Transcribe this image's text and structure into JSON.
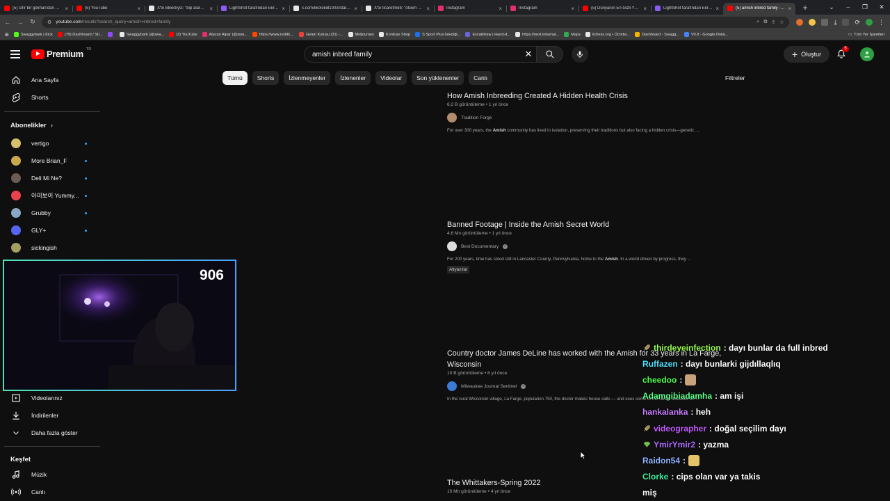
{
  "browser": {
    "tabs": [
      {
        "label": "(5) sıfır bir gökhan'dan mesaj",
        "fav_color": "#ff0000",
        "active": false
      },
      {
        "label": "(5) YouTube",
        "fav_color": "#ff0000",
        "active": false
      },
      {
        "label": "X'te BBeckyG: \"bip alarmı ...",
        "fav_color": "#e7e7e7",
        "active": false
      },
      {
        "label": "LightShot tarafından Ekran ...",
        "fav_color": "#8b5cf6",
        "active": false
      },
      {
        "label": "x.com/kkoloki81003/statu...",
        "fav_color": "#e7e7e7",
        "active": false
      },
      {
        "label": "X'te ticaretmeb: \"ölcem an...",
        "fav_color": "#e7e7e7",
        "active": false
      },
      {
        "label": "Instagram",
        "fav_color": "#e1306c",
        "active": false
      },
      {
        "label": "Instagram",
        "fav_color": "#e1306c",
        "active": false
      },
      {
        "label": "(5) Dünyanın En Gizli Yaba...",
        "fav_color": "#ff0000",
        "active": false
      },
      {
        "label": "LightShot tarafından Ekran ...",
        "fav_color": "#8b5cf6",
        "active": false
      },
      {
        "label": "(5) amish inbred family - Yo",
        "fav_color": "#ff0000",
        "active": true
      }
    ],
    "url_host": "youtube.com",
    "url_path": "/results?search_query=amish+inbred+family",
    "bookmarks": [
      {
        "label": "Swaggybark | Kick",
        "color": "#53fc18"
      },
      {
        "label": "(79) Dashboard / Str...",
        "color": "#ff0000"
      },
      {
        "label": "",
        "color": "#9146ff"
      },
      {
        "label": "Swaggybark (@swa...",
        "color": "#e7e7e7"
      },
      {
        "label": "(2) YouTube",
        "color": "#ff0000"
      },
      {
        "label": "Alpcan Alpar (@swa...",
        "color": "#e1306c"
      },
      {
        "label": "https://www.reddit....",
        "color": "#ff4500"
      },
      {
        "label": "Gelen Kutusu (31) -...",
        "color": "#ea4335"
      },
      {
        "label": "Midjourney",
        "color": "#e7e7e7"
      },
      {
        "label": "Konfuse Shop",
        "color": "#e7e7e7"
      },
      {
        "label": "S Sport Plus-İstediği...",
        "color": "#1a73e8"
      },
      {
        "label": "Excalidraw | Hand-d...",
        "color": "#6965db"
      },
      {
        "label": "https://next.inkamat...",
        "color": "#e7e7e7"
      },
      {
        "label": "Maps",
        "color": "#34a853"
      },
      {
        "label": "lichess.org • Ücretsi...",
        "color": "#e7e7e7"
      },
      {
        "label": "Dashboard - Swagg...",
        "color": "#f4b400"
      },
      {
        "label": "V0.8 - Google Dokü...",
        "color": "#4285f4"
      }
    ],
    "all_bookmarks": "Tüm Yer İşaretleri"
  },
  "header": {
    "logo_text": "Premium",
    "region": "TR",
    "search_query": "amish inbred family",
    "create_label": "Oluştur",
    "notifications": "5"
  },
  "sidebar": {
    "home": "Ana Sayfa",
    "shorts": "Shorts",
    "subs_heading": "Abonelikler",
    "subscriptions": [
      {
        "name": "vertigo",
        "color": "#d4c06a"
      },
      {
        "name": "More Brian_F",
        "color": "#c9a74f"
      },
      {
        "name": "Deli Mi Ne?",
        "color": "#6b5d55"
      },
      {
        "name": "아미보이 Yummy...",
        "color": "#e8424e"
      },
      {
        "name": "Grubby",
        "color": "#8aa8c4"
      },
      {
        "name": "GLY+",
        "color": "#5865f2"
      },
      {
        "name": "sickingish",
        "color": "#a0a060"
      }
    ],
    "videos": "Videolarınız",
    "downloads": "İndirilenler",
    "show_more": "Daha fazla göster",
    "explore_heading": "Keşfet",
    "music": "Müzik",
    "live": "Canlı"
  },
  "chips": [
    "Tümü",
    "Shorts",
    "İzlenmeyenler",
    "İzlenenler",
    "Videolar",
    "Son yüklenenler",
    "Canlı"
  ],
  "filters_label": "Filtreler",
  "results": [
    {
      "title": "How Amish Inbreeding Created A Hidden Health Crisis",
      "views": "6,2 B görüntüleme",
      "age": "1 yıl önce",
      "channel": "Tradition Forge",
      "verified": false,
      "channel_color": "#b38b6d",
      "desc_pre": "For over 300 years, the ",
      "desc_bold": "Amish",
      "desc_post": " community has lived in isolation, preserving their traditions but also facing a hidden crisis—genetic ...",
      "tag": ""
    },
    {
      "title": "Banned Footage | Inside the Amish Secret World",
      "views": "4,6 Mn görüntüleme",
      "age": "1 yıl önce",
      "channel": "Best Documentary",
      "verified": true,
      "channel_color": "#dcdcdc",
      "desc_pre": "For 200 years, time has stood still in Lancaster County, Pennsylvania, home to the ",
      "desc_bold": "Amish",
      "desc_post": ". In a world driven by progress, they ...",
      "tag": "Altyazılar"
    },
    {
      "title": "Country doctor James DeLine has worked with the Amish for 33 years in La Farge, Wisconsin",
      "views": "10 B görüntüleme",
      "age": "6 yıl önce",
      "channel": "Milwaukee Journal Sentinel",
      "verified": true,
      "channel_color": "#3a7bd5",
      "desc_pre": "In the rural Wisconsin village, La Farge, population 750, the doctor makes house calls — and sees some of the rarest diseases on ...",
      "desc_bold": "",
      "desc_post": "",
      "tag": ""
    },
    {
      "title": "The Whittakers-Spring 2022",
      "views": "10 Mn görüntüleme",
      "age": "4 yıl önce",
      "channel": "",
      "verified": false,
      "channel_color": "",
      "desc_pre": "",
      "desc_bold": "",
      "desc_post": "",
      "tag": ""
    }
  ],
  "webcam": {
    "counter": "906"
  },
  "chat": [
    {
      "user": "thirdeyeinfection",
      "color": "#9aff4f",
      "text": ": dayı bunlar da full inbred",
      "badge": "sword",
      "emote": ""
    },
    {
      "user": "Ruffazen",
      "color": "#4fe3ff",
      "text": ": dayı bunlarki gijdıllaqlıq",
      "badge": "",
      "emote": ""
    },
    {
      "user": "cheedoo",
      "color": "#4cff4c",
      "text": ":",
      "badge": "",
      "emote": "#c8a27a"
    },
    {
      "user": "Adamgibiadamha",
      "color": "#5fff8a",
      "text": ": am işi",
      "badge": "",
      "emote": ""
    },
    {
      "user": "hankalanka",
      "color": "#c77dff",
      "text": ": heh",
      "badge": "",
      "emote": ""
    },
    {
      "user": "videographer",
      "color": "#c45cff",
      "text": ": doğal seçilim dayı",
      "badge": "sword",
      "emote": ""
    },
    {
      "user": "YmirYmir2",
      "color": "#b06cff",
      "text": ": yazma",
      "badge": "gem",
      "emote": ""
    },
    {
      "user": "Raidon54",
      "color": "#8fb4ff",
      "text": ":",
      "badge": "",
      "emote": "#e6c36a"
    },
    {
      "user": "Clorke",
      "color": "#3ff0a0",
      "text": ": cips olan var ya takis",
      "badge": "",
      "emote": ""
    },
    {
      "user": "",
      "color": "#ffffff",
      "text": "miş",
      "badge": "",
      "emote": ""
    }
  ]
}
